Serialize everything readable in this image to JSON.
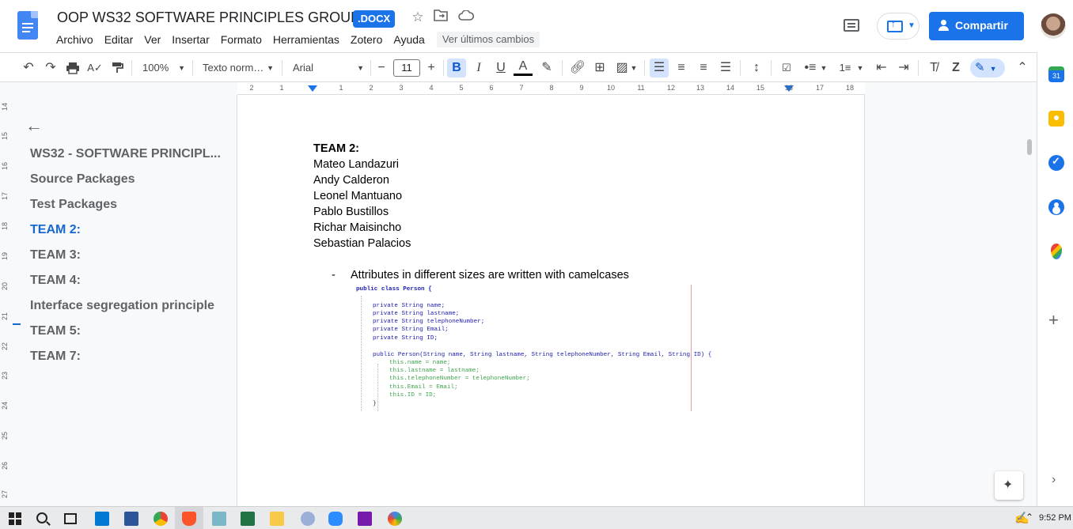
{
  "header": {
    "doc_title": "OOP WS32 SOFTWARE PRINCIPLES GROUPS",
    "badge": ".DOCX",
    "menu": [
      "Archivo",
      "Editar",
      "Ver",
      "Insertar",
      "Formato",
      "Herramientas",
      "Zotero",
      "Ayuda"
    ],
    "last_edit": "Ver últimos cambios",
    "share_label": "Compartir"
  },
  "toolbar": {
    "zoom": "100%",
    "style": "Texto norm…",
    "font": "Arial",
    "font_size": "11"
  },
  "ruler": {
    "ticks": [
      "2",
      "1",
      "1",
      "2",
      "3",
      "4",
      "5",
      "6",
      "7",
      "8",
      "9",
      "10",
      "11",
      "12",
      "13",
      "14",
      "15",
      "16",
      "17",
      "18"
    ]
  },
  "vruler": {
    "ticks": [
      "14",
      "15",
      "16",
      "17",
      "18",
      "19",
      "20",
      "21",
      "22",
      "23",
      "24",
      "25",
      "26",
      "27"
    ]
  },
  "outline": {
    "items": [
      {
        "label": "WS32 - SOFTWARE PRINCIPL..."
      },
      {
        "label": "Source Packages"
      },
      {
        "label": "Test Packages"
      },
      {
        "label": "TEAM 2:"
      },
      {
        "label": "TEAM 3:"
      },
      {
        "label": "TEAM 4:"
      },
      {
        "label": "Interface segregation principle"
      },
      {
        "label": "TEAM 5:"
      },
      {
        "label": "TEAM 7:"
      }
    ],
    "active_index": 3
  },
  "document": {
    "heading": "TEAM 2:",
    "members": [
      "Mateo Landazuri",
      "Andy Calderon",
      "Leonel Mantuano",
      "Pablo Bustillos",
      "Richar Maisincho",
      "Sebastian Palacios"
    ],
    "bullet_marker": "-",
    "bullet_text": "Attributes in different sizes are written with camelcases",
    "code": {
      "class_line": "public class Person {",
      "fields": [
        "private String name;",
        "private String lastname;",
        "private String telephoneNumber;",
        "private String Email;",
        "private String ID;"
      ],
      "ctor_line": "public Person(String name, String lastname, String telephoneNumber, String Email, String ID) {",
      "body": [
        "this.name = name;",
        "this.lastname = lastname;",
        "this.telephoneNumber = telephoneNumber;",
        "this.Email = Email;",
        "this.ID = ID;"
      ],
      "close": "}"
    }
  },
  "sidepanel": {
    "calendar_day": "31"
  },
  "taskbar": {
    "time": "9:52 PM"
  },
  "colors": {
    "accent": "#1a73e8",
    "active_outline": "#1967d2"
  }
}
